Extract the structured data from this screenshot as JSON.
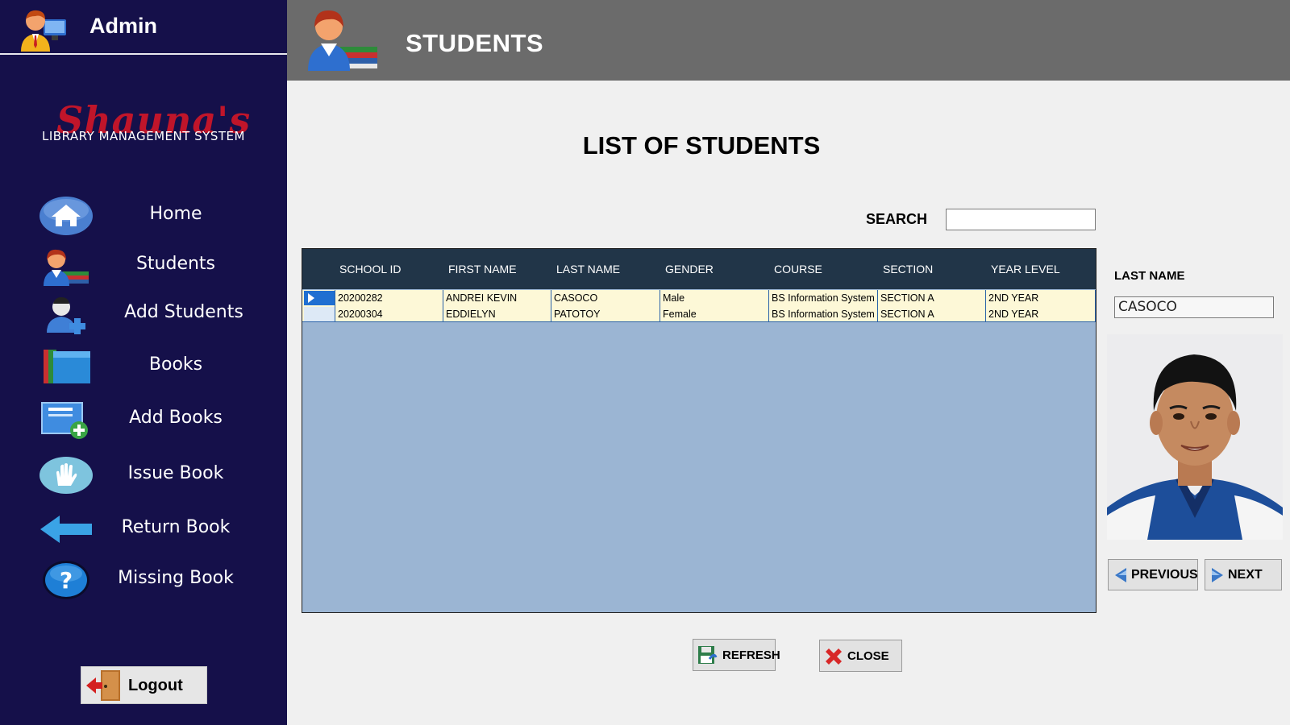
{
  "sidebar": {
    "user_label": "Admin",
    "logo_script": "Shauna's",
    "logo_subtitle": "LIBRARY MANAGEMENT SYSTEM",
    "items": [
      {
        "label": "Home",
        "icon": "home-icon"
      },
      {
        "label": "Students",
        "icon": "student-icon"
      },
      {
        "label": "Add Students",
        "icon": "add-user-icon"
      },
      {
        "label": "Books",
        "icon": "books-icon"
      },
      {
        "label": "Add Books",
        "icon": "add-book-icon"
      },
      {
        "label": "Issue Book",
        "icon": "hand-icon"
      },
      {
        "label": "Return Book",
        "icon": "arrow-left-icon"
      },
      {
        "label": "Missing Book",
        "icon": "question-icon"
      }
    ],
    "logout_label": "Logout"
  },
  "header": {
    "title": "STUDENTS"
  },
  "main": {
    "list_title": "LIST OF STUDENTS",
    "search_label": "SEARCH",
    "search_value": "",
    "columns": [
      "SCHOOL ID",
      "FIRST NAME",
      "LAST NAME",
      "GENDER",
      "COURSE",
      "SECTION",
      "YEAR LEVEL"
    ],
    "rows": [
      [
        "20200282",
        "ANDREI KEVIN",
        "CASOCO",
        "Male",
        "BS Information System",
        "SECTION A",
        "2ND YEAR"
      ],
      [
        "20200304",
        "EDDIELYN",
        "PATOTOY",
        "Female",
        "BS Information System",
        "SECTION A",
        "2ND YEAR"
      ]
    ],
    "selected_row": 0
  },
  "detail": {
    "last_name_label": "LAST NAME",
    "last_name_value": "CASOCO",
    "previous_label": "PREVIOUS",
    "next_label": "NEXT"
  },
  "footer": {
    "refresh_label": "REFRESH",
    "close_label": "CLOSE"
  },
  "colors": {
    "sidebar_bg": "#15104a",
    "header_bg": "#6b6b6b",
    "grid_header_bg": "#213548",
    "grid_body_bg": "#9bb5d3",
    "row_bg": "#fdf8d7",
    "logo_red": "#c0152a"
  }
}
